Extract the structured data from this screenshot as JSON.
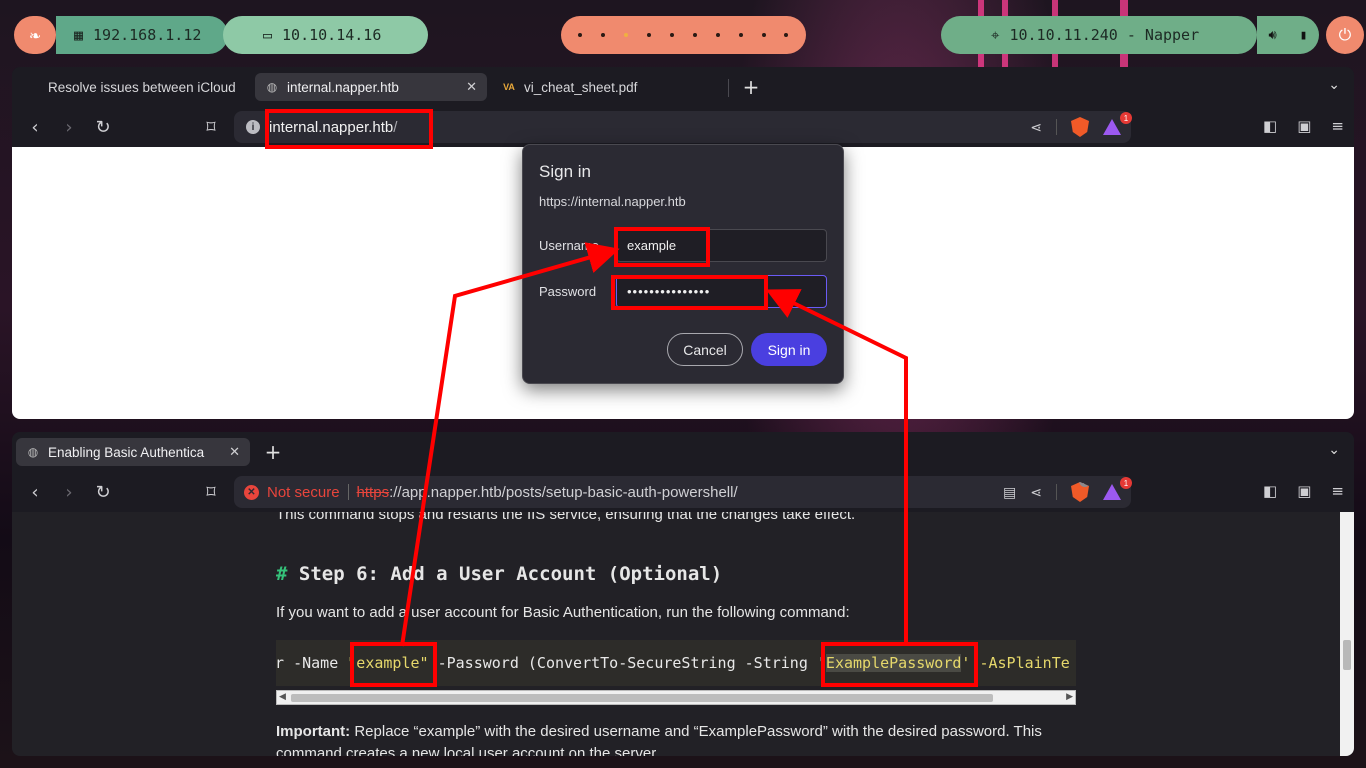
{
  "panel": {
    "ip_local": "192.168.1.12",
    "ip_vpn": "10.10.14.16",
    "target": "10.10.11.240 - Napper",
    "workspaces": [
      1,
      2,
      3,
      4,
      5,
      6,
      7,
      8,
      9,
      10
    ]
  },
  "top_browser": {
    "tabs": [
      {
        "label": "Resolve issues between iCloud",
        "icon": "apple-icon"
      },
      {
        "label": "internal.napper.htb",
        "icon": "globe-icon"
      },
      {
        "label": "vi_cheat_sheet.pdf",
        "icon": "pdf-icon"
      }
    ],
    "url_host": "internal.napper.htb",
    "url_path": "/",
    "brave_badge": "1"
  },
  "dialog": {
    "title": "Sign in",
    "origin": "https://internal.napper.htb",
    "username_label": "Username",
    "username_value": "example",
    "password_label": "Password",
    "password_value": "•••••••••••••••",
    "cancel": "Cancel",
    "submit": "Sign in"
  },
  "bottom_browser": {
    "tab_label": "Enabling Basic Authentica",
    "security": "Not secure",
    "url_scheme": "https",
    "url_rest": "://app.napper.htb/posts/setup-basic-auth-powershell/",
    "shield_badge": "1",
    "alert_badge": "1"
  },
  "article": {
    "top_line": "This command stops and restarts the IIS service, ensuring that the changes take effect.",
    "heading_hash": "#",
    "heading": "Step 6: Add a User Account (Optional)",
    "intro": "If you want to add a user account for Basic Authentication, run the following command:",
    "code_pre": "er -Name ",
    "code_user": "\"example\"",
    "code_mid": " -Password (ConvertTo-SecureString -String '",
    "code_pass": "ExamplePassword",
    "code_post": "' -AsPlainTe",
    "important_label": "Important:",
    "important_text": " Replace “example” with the desired username and “ExamplePassword” with the desired password. This",
    "important_line2": "command creates a new local user account on the server."
  }
}
